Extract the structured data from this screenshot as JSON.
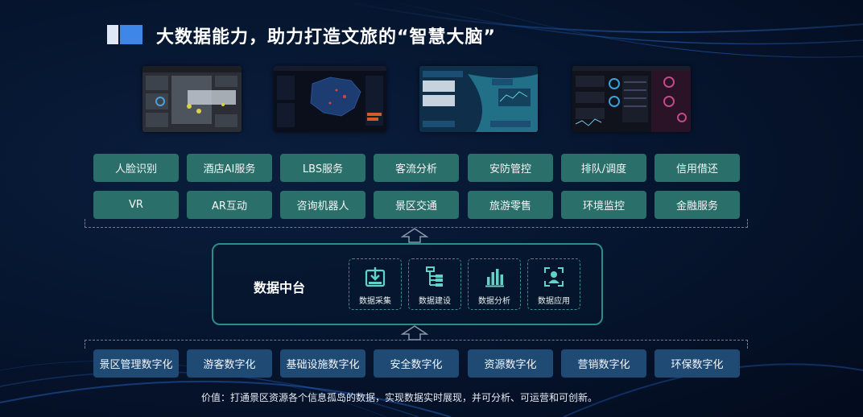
{
  "title": "大数据能力，助力打造文旅的“智慧大脑”",
  "services_row1": [
    "人脸识别",
    "酒店AI服务",
    "LBS服务",
    "客流分析",
    "安防管控",
    "排队/调度",
    "信用借还"
  ],
  "services_row2": [
    "VR",
    "AR互动",
    "咨询机器人",
    "景区交通",
    "旅游零售",
    "环境监控",
    "金融服务"
  ],
  "platform": {
    "title": "数据中台",
    "cards": [
      {
        "label": "数据采集",
        "icon": "download-box-icon"
      },
      {
        "label": "数据建设",
        "icon": "hierarchy-icon"
      },
      {
        "label": "数据分析",
        "icon": "bar-chart-icon"
      },
      {
        "label": "数据应用",
        "icon": "user-frame-icon"
      }
    ]
  },
  "digitalization": [
    "景区管理数字化",
    "游客数字化",
    "基础设施数字化",
    "安全数字化",
    "资源数字化",
    "营销数字化",
    "环保数字化"
  ],
  "footer": "价值：打通景区资源各个信息孤岛的数据，实现数据实时展现，并可分析、可运营和可创新。",
  "colors": {
    "service_tile": "#2a6f6a",
    "digital_tile": "#1e4a74",
    "platform_border": "#2d8c86",
    "accent": "#3e86e8"
  }
}
